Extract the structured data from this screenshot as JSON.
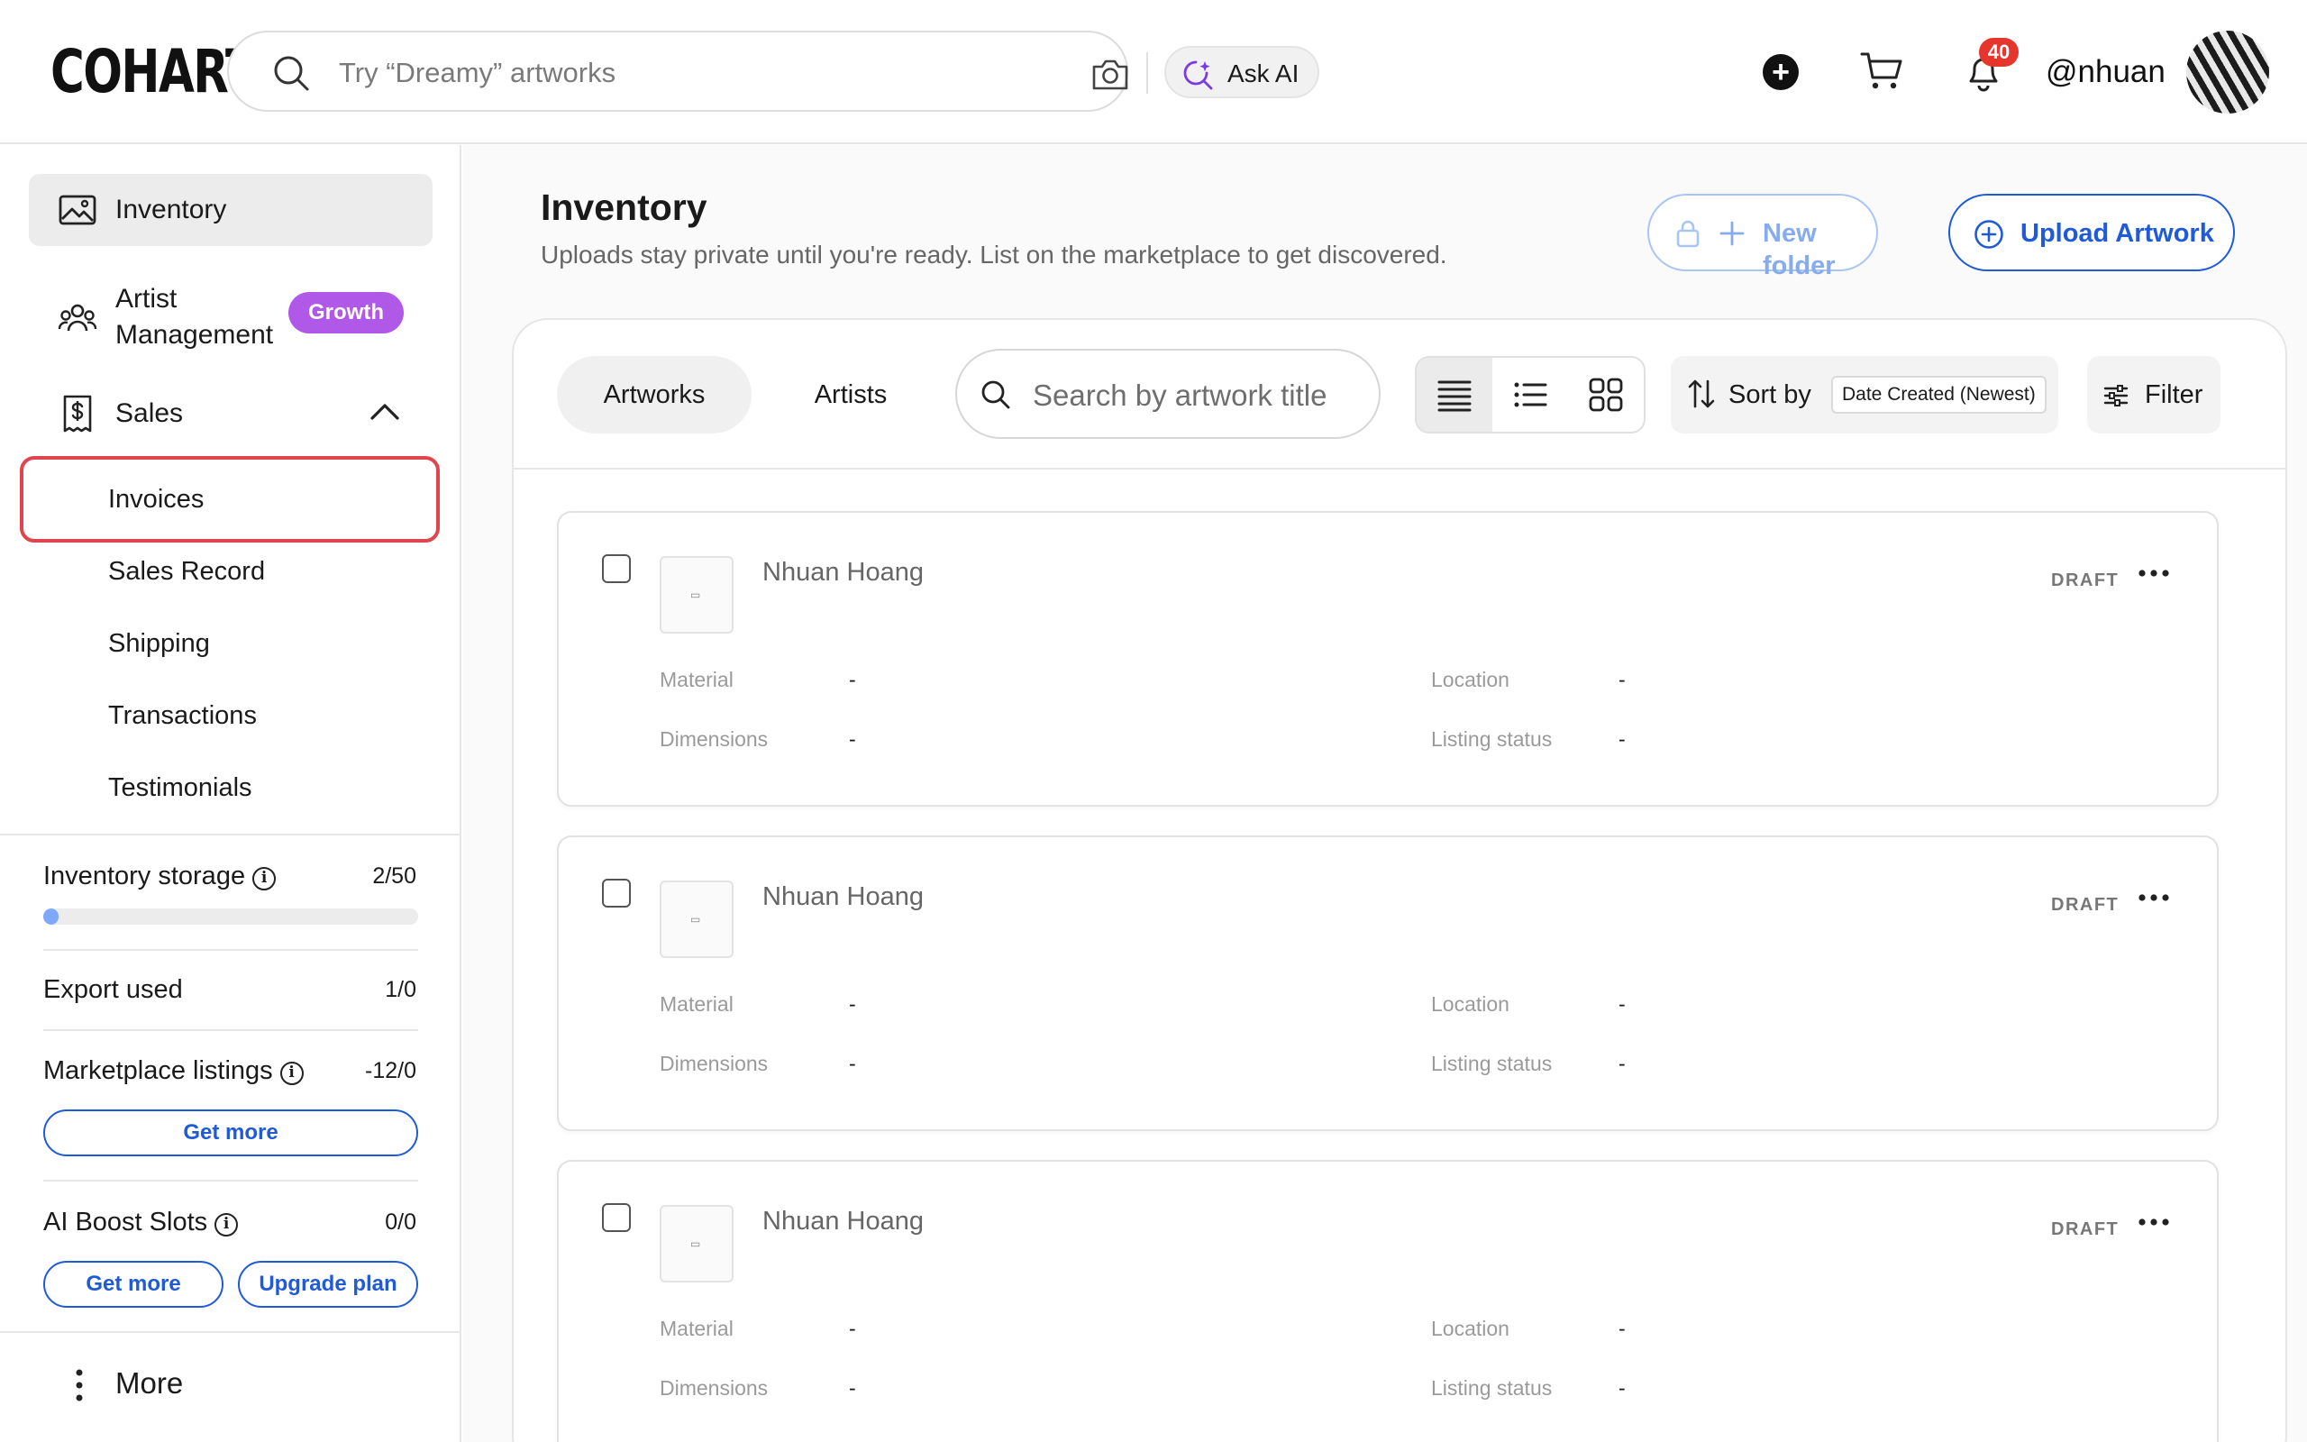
{
  "header": {
    "logo": "COHART",
    "search_placeholder": "Try “Dreamy” artworks",
    "ask_ai_label": "Ask AI",
    "notification_count": "40",
    "username": "@nhuan"
  },
  "sidebar": {
    "items": [
      {
        "label": "Inventory",
        "icon": "image-icon",
        "active": true
      },
      {
        "label_line1": "Artist",
        "label_line2": "Management",
        "icon": "people-icon",
        "badge": "Growth"
      },
      {
        "label": "Sales",
        "icon": "dollar-doc-icon",
        "expanded": true
      }
    ],
    "sales_subitems": [
      "Invoices",
      "Sales Record",
      "Shipping",
      "Transactions",
      "Testimonials"
    ],
    "usage": {
      "inventory_storage": {
        "label": "Inventory storage",
        "value": "2/50",
        "fill_fraction": 0.04
      },
      "export_used": {
        "label": "Export used",
        "value": "1/0"
      },
      "marketplace_listings": {
        "label": "Marketplace listings",
        "value": "-12/0",
        "button": "Get more"
      },
      "ai_boost_slots": {
        "label": "AI Boost Slots",
        "value": "0/0",
        "button_get_more": "Get more",
        "button_upgrade": "Upgrade plan"
      }
    },
    "more_label": "More"
  },
  "main": {
    "title": "Inventory",
    "subtitle": "Uploads stay private until you're ready. List on the marketplace to get discovered.",
    "new_folder_label": "New folder",
    "upload_label": "Upload Artwork",
    "tabs": [
      "Artworks",
      "Artists"
    ],
    "search_placeholder": "Search by artwork title",
    "sort_label": "Sort by",
    "sort_value": "Date Created (Newest)",
    "filter_label": "Filter",
    "field_labels": {
      "material": "Material",
      "dimensions": "Dimensions",
      "location": "Location",
      "listing_status": "Listing status"
    },
    "artworks": [
      {
        "artist": "Nhuan Hoang",
        "status": "DRAFT",
        "material": "-",
        "dimensions": "-",
        "location": "-",
        "listing_status": "-"
      },
      {
        "artist": "Nhuan Hoang",
        "status": "DRAFT",
        "material": "-",
        "dimensions": "-",
        "location": "-",
        "listing_status": "-"
      },
      {
        "artist": "Nhuan Hoang",
        "status": "DRAFT",
        "material": "-",
        "dimensions": "-",
        "location": "-",
        "listing_status": "-"
      }
    ]
  },
  "colors": {
    "accent_blue": "#1f5ad9",
    "growth_purple": "#b058e8",
    "highlight_red": "#e0454d",
    "badge_red": "#e5352c"
  }
}
